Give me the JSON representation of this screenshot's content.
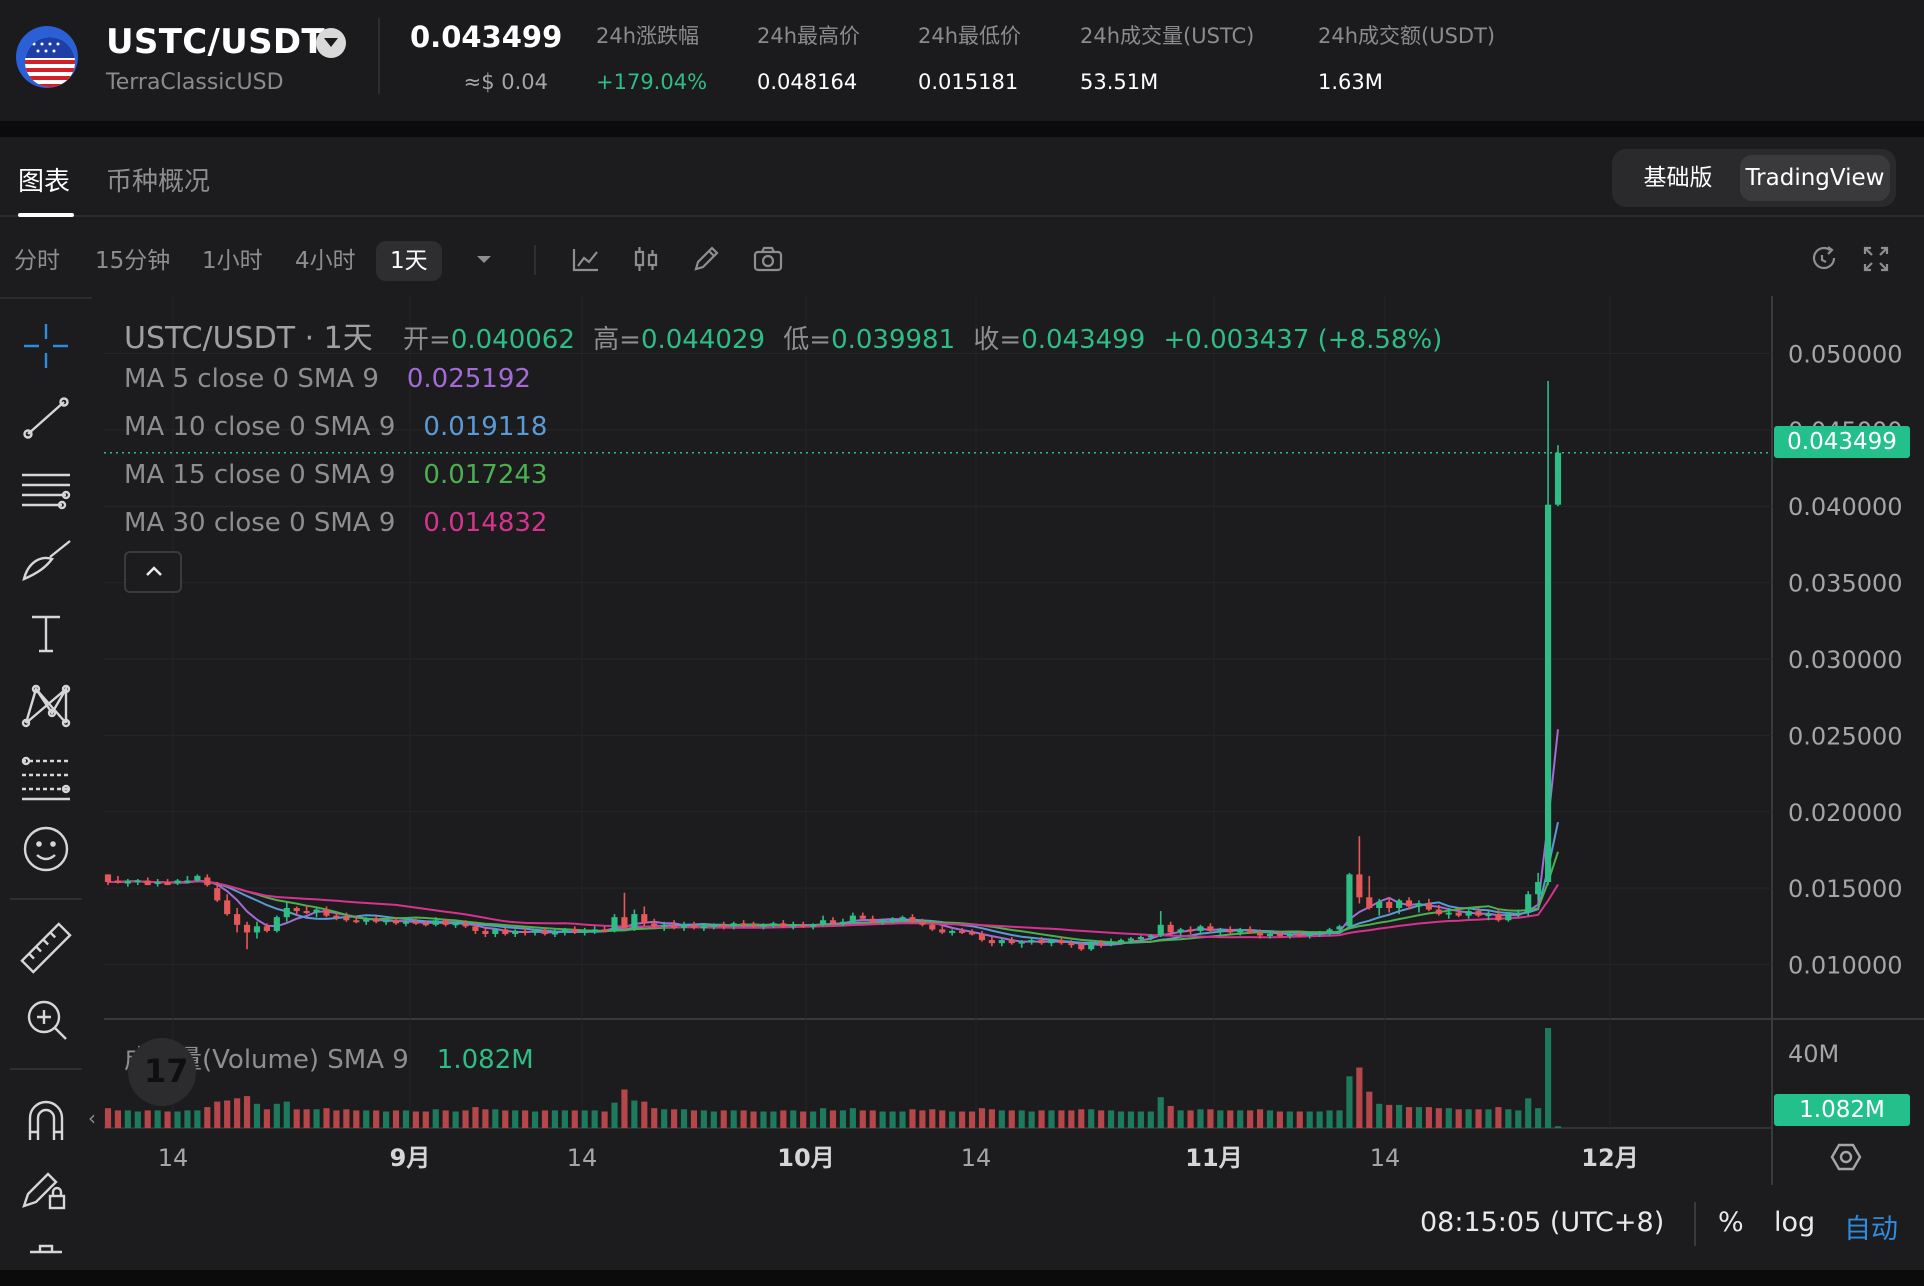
{
  "header": {
    "pair": "USTC/USDT",
    "subtitle": "TerraClassicUSD",
    "last_price": "0.043499",
    "last_price_usd": "≈$ 0.04",
    "stats": [
      {
        "label": "24h涨跌幅",
        "value": "+179.04%",
        "up": true
      },
      {
        "label": "24h最高价",
        "value": "0.048164",
        "up": false
      },
      {
        "label": "24h最低价",
        "value": "0.015181",
        "up": false
      },
      {
        "label": "24h成交量(USTC)",
        "value": "53.51M",
        "up": false
      },
      {
        "label": "24h成交额(USDT)",
        "value": "1.63M",
        "up": false
      }
    ]
  },
  "tabs": [
    {
      "label": "图表",
      "active": true
    },
    {
      "label": "币种概况",
      "active": false
    }
  ],
  "modes": [
    {
      "label": "基础版",
      "active": false
    },
    {
      "label": "TradingView",
      "active": true
    }
  ],
  "timeframes": [
    {
      "label": "分时",
      "active": false
    },
    {
      "label": "15分钟",
      "active": false
    },
    {
      "label": "1小时",
      "active": false
    },
    {
      "label": "4小时",
      "active": false
    },
    {
      "label": "1天",
      "active": true
    }
  ],
  "toolbar_icons": [
    "chevron-down-icon",
    "line-chart-icon",
    "candlestick-icon",
    "pencil-icon",
    "camera-icon",
    "refresh-icon",
    "fullscreen-icon"
  ],
  "side_icons": [
    "crosshair-icon",
    "trend-line-icon",
    "horizontal-lines-icon",
    "brush-icon",
    "text-icon",
    "pattern-icon",
    "fib-icon",
    "emoji-icon",
    "ruler-icon",
    "zoom-in-icon",
    "magnet-icon",
    "lock-draw-icon",
    "trash-icon"
  ],
  "ohlc": {
    "symbol": "USTC/USDT · 1天",
    "open_label": "开=",
    "open": "0.040062",
    "high_label": "高=",
    "high": "0.044029",
    "low_label": "低=",
    "low": "0.039981",
    "close_label": "收=",
    "close": "0.043499",
    "change": "+0.003437 (+8.58%)"
  },
  "ma_legend": [
    {
      "label": "MA 5 close 0 SMA 9",
      "value": "0.025192",
      "color": "#a46bd6"
    },
    {
      "label": "MA 10 close 0 SMA 9",
      "value": "0.019118",
      "color": "#5b9bd5"
    },
    {
      "label": "MA 15 close 0 SMA 9",
      "value": "0.017243",
      "color": "#4caf50"
    },
    {
      "label": "MA 30 close 0 SMA 9",
      "value": "0.014832",
      "color": "#d6338f"
    }
  ],
  "volume_legend": {
    "label": "成交量(Volume) SMA 9",
    "value": "1.082M"
  },
  "price_axis": [
    "0.050000",
    "0.045000",
    "0.040000",
    "0.035000",
    "0.030000",
    "0.025000",
    "0.020000",
    "0.015000",
    "0.010000"
  ],
  "current_price_tag": "0.043499",
  "volume_axis": "40M",
  "volume_tag": "1.082M",
  "time_axis": [
    "14",
    "9月",
    "14",
    "10月",
    "14",
    "11月",
    "14",
    "12月"
  ],
  "clock": "08:15:05 (UTC+8)",
  "bottom_options": [
    {
      "label": "%",
      "active": false
    },
    {
      "label": "log",
      "active": false
    },
    {
      "label": "自动",
      "active": true
    }
  ],
  "colors": {
    "up": "#26a17b",
    "up_bright": "#2ebd85",
    "down": "#e4585a",
    "price_line": "#24c08c"
  },
  "chart_data": {
    "type": "candlestick",
    "ylim": [
      0.0065,
      0.0535
    ],
    "y_ticks": [
      0.05,
      0.045,
      0.04,
      0.035,
      0.03,
      0.025,
      0.02,
      0.015,
      0.01
    ],
    "last_close": 0.043499,
    "candles": [
      [
        0.0159,
        0.0159,
        0.0152,
        0.0154
      ],
      [
        0.0155,
        0.0158,
        0.0153,
        0.0154
      ],
      [
        0.0153,
        0.0156,
        0.0151,
        0.0155
      ],
      [
        0.0154,
        0.0156,
        0.0152,
        0.0155
      ],
      [
        0.0155,
        0.0157,
        0.0152,
        0.0152
      ],
      [
        0.0153,
        0.0156,
        0.0151,
        0.0154
      ],
      [
        0.0154,
        0.0156,
        0.0152,
        0.0152
      ],
      [
        0.0153,
        0.0156,
        0.0152,
        0.0155
      ],
      [
        0.0155,
        0.0158,
        0.0153,
        0.0155
      ],
      [
        0.0155,
        0.0159,
        0.0154,
        0.0158
      ],
      [
        0.0157,
        0.0159,
        0.0151,
        0.0152
      ],
      [
        0.015,
        0.0154,
        0.0141,
        0.0142
      ],
      [
        0.0142,
        0.0146,
        0.0132,
        0.0133
      ],
      [
        0.0133,
        0.0137,
        0.0121,
        0.0126
      ],
      [
        0.0126,
        0.0128,
        0.011,
        0.0121
      ],
      [
        0.0121,
        0.0128,
        0.0117,
        0.0125
      ],
      [
        0.0125,
        0.0127,
        0.0121,
        0.0122
      ],
      [
        0.0122,
        0.0132,
        0.0121,
        0.0131
      ],
      [
        0.0131,
        0.0141,
        0.0128,
        0.0137
      ],
      [
        0.0137,
        0.0138,
        0.0132,
        0.0135
      ],
      [
        0.0135,
        0.0139,
        0.0133,
        0.0134
      ],
      [
        0.0134,
        0.0137,
        0.0131,
        0.0136
      ],
      [
        0.0136,
        0.0138,
        0.0131,
        0.0132
      ],
      [
        0.0132,
        0.0134,
        0.0129,
        0.0131
      ],
      [
        0.0131,
        0.0134,
        0.0128,
        0.0129
      ],
      [
        0.0129,
        0.0132,
        0.0127,
        0.0128
      ],
      [
        0.0128,
        0.0131,
        0.0126,
        0.013
      ],
      [
        0.013,
        0.0132,
        0.0127,
        0.0128
      ],
      [
        0.0128,
        0.013,
        0.0126,
        0.0129
      ],
      [
        0.0129,
        0.0131,
        0.0126,
        0.0127
      ],
      [
        0.0127,
        0.013,
        0.0125,
        0.0128
      ],
      [
        0.0128,
        0.013,
        0.0126,
        0.0127
      ],
      [
        0.0127,
        0.0129,
        0.0125,
        0.0126
      ],
      [
        0.0126,
        0.0131,
        0.0125,
        0.0129
      ],
      [
        0.0129,
        0.013,
        0.0125,
        0.0126
      ],
      [
        0.0126,
        0.0128,
        0.0124,
        0.0127
      ],
      [
        0.0127,
        0.0129,
        0.0124,
        0.0125
      ],
      [
        0.0125,
        0.0128,
        0.012,
        0.0122
      ],
      [
        0.0122,
        0.0124,
        0.0118,
        0.012
      ],
      [
        0.012,
        0.0124,
        0.0118,
        0.0123
      ],
      [
        0.0123,
        0.0124,
        0.0119,
        0.012
      ],
      [
        0.012,
        0.0123,
        0.0118,
        0.0122
      ],
      [
        0.0122,
        0.0124,
        0.0119,
        0.0121
      ],
      [
        0.0121,
        0.0123,
        0.0119,
        0.0122
      ],
      [
        0.0122,
        0.0124,
        0.0119,
        0.012
      ],
      [
        0.012,
        0.0123,
        0.0118,
        0.0121
      ],
      [
        0.0121,
        0.0124,
        0.0119,
        0.0123
      ],
      [
        0.0123,
        0.0125,
        0.012,
        0.0121
      ],
      [
        0.0121,
        0.0124,
        0.0119,
        0.0122
      ],
      [
        0.0122,
        0.0125,
        0.012,
        0.0123
      ],
      [
        0.0123,
        0.0125,
        0.0121,
        0.0122
      ],
      [
        0.0122,
        0.0133,
        0.0121,
        0.0131
      ],
      [
        0.0131,
        0.0147,
        0.0123,
        0.0124
      ],
      [
        0.0124,
        0.0136,
        0.0122,
        0.0133
      ],
      [
        0.0133,
        0.0138,
        0.0125,
        0.0127
      ],
      [
        0.0127,
        0.013,
        0.0123,
        0.0125
      ],
      [
        0.0125,
        0.0128,
        0.0122,
        0.0126
      ],
      [
        0.0126,
        0.0129,
        0.0123,
        0.0124
      ],
      [
        0.0124,
        0.0128,
        0.0122,
        0.0126
      ],
      [
        0.0126,
        0.0128,
        0.0123,
        0.0124
      ],
      [
        0.0124,
        0.0127,
        0.0122,
        0.0125
      ],
      [
        0.0125,
        0.0127,
        0.0123,
        0.0126
      ],
      [
        0.0126,
        0.0128,
        0.0123,
        0.0125
      ],
      [
        0.0125,
        0.0128,
        0.0123,
        0.0127
      ],
      [
        0.0127,
        0.0129,
        0.0124,
        0.0126
      ],
      [
        0.0126,
        0.0128,
        0.0124,
        0.0125
      ],
      [
        0.0125,
        0.0127,
        0.0123,
        0.0126
      ],
      [
        0.0126,
        0.0128,
        0.0124,
        0.0127
      ],
      [
        0.0127,
        0.0129,
        0.0124,
        0.0125
      ],
      [
        0.0125,
        0.0128,
        0.0123,
        0.0126
      ],
      [
        0.0126,
        0.0128,
        0.0124,
        0.0125
      ],
      [
        0.0125,
        0.0127,
        0.0123,
        0.0126
      ],
      [
        0.0126,
        0.0132,
        0.0125,
        0.0129
      ],
      [
        0.0129,
        0.0131,
        0.0126,
        0.0127
      ],
      [
        0.0127,
        0.013,
        0.0125,
        0.0128
      ],
      [
        0.0128,
        0.0134,
        0.0127,
        0.0132
      ],
      [
        0.0132,
        0.0134,
        0.0129,
        0.013
      ],
      [
        0.013,
        0.0132,
        0.0127,
        0.0128
      ],
      [
        0.0128,
        0.013,
        0.0126,
        0.0129
      ],
      [
        0.0129,
        0.0131,
        0.0127,
        0.013
      ],
      [
        0.013,
        0.0132,
        0.0128,
        0.0131
      ],
      [
        0.0131,
        0.0133,
        0.0127,
        0.0128
      ],
      [
        0.0128,
        0.013,
        0.0125,
        0.0126
      ],
      [
        0.0126,
        0.0128,
        0.0122,
        0.0123
      ],
      [
        0.0123,
        0.0125,
        0.012,
        0.0121
      ],
      [
        0.0121,
        0.0123,
        0.0119,
        0.0122
      ],
      [
        0.0122,
        0.0124,
        0.012,
        0.0121
      ],
      [
        0.0121,
        0.0123,
        0.0119,
        0.012
      ],
      [
        0.012,
        0.0122,
        0.0115,
        0.0116
      ],
      [
        0.0116,
        0.0118,
        0.0112,
        0.0114
      ],
      [
        0.0114,
        0.0117,
        0.0112,
        0.0116
      ],
      [
        0.0116,
        0.0118,
        0.0113,
        0.0114
      ],
      [
        0.0114,
        0.0116,
        0.0111,
        0.0115
      ],
      [
        0.0115,
        0.0117,
        0.0113,
        0.0116
      ],
      [
        0.0116,
        0.0118,
        0.0113,
        0.0114
      ],
      [
        0.0114,
        0.0117,
        0.0112,
        0.0116
      ],
      [
        0.0116,
        0.0118,
        0.0113,
        0.0114
      ],
      [
        0.0114,
        0.0116,
        0.0111,
        0.0113
      ],
      [
        0.0113,
        0.0115,
        0.0109,
        0.011
      ],
      [
        0.011,
        0.0115,
        0.0109,
        0.0114
      ],
      [
        0.0114,
        0.0116,
        0.0111,
        0.0113
      ],
      [
        0.0113,
        0.0117,
        0.0112,
        0.0115
      ],
      [
        0.0115,
        0.0117,
        0.0113,
        0.0116
      ],
      [
        0.0116,
        0.0118,
        0.0114,
        0.0117
      ],
      [
        0.0117,
        0.0119,
        0.0115,
        0.0118
      ],
      [
        0.0118,
        0.012,
        0.0116,
        0.0119
      ],
      [
        0.0119,
        0.0135,
        0.0118,
        0.0126
      ],
      [
        0.0126,
        0.0128,
        0.0119,
        0.0121
      ],
      [
        0.0121,
        0.0124,
        0.0119,
        0.0123
      ],
      [
        0.0123,
        0.0125,
        0.012,
        0.0122
      ],
      [
        0.0122,
        0.0126,
        0.012,
        0.0125
      ],
      [
        0.0125,
        0.0127,
        0.0121,
        0.0122
      ],
      [
        0.0122,
        0.0124,
        0.0119,
        0.0123
      ],
      [
        0.0123,
        0.0125,
        0.012,
        0.0121
      ],
      [
        0.0121,
        0.0124,
        0.0119,
        0.0123
      ],
      [
        0.0123,
        0.0125,
        0.012,
        0.0121
      ],
      [
        0.0121,
        0.0123,
        0.0117,
        0.0119
      ],
      [
        0.0119,
        0.0122,
        0.0117,
        0.012
      ],
      [
        0.012,
        0.0122,
        0.0118,
        0.0119
      ],
      [
        0.0119,
        0.0121,
        0.0117,
        0.012
      ],
      [
        0.012,
        0.0122,
        0.0118,
        0.0119
      ],
      [
        0.0119,
        0.0121,
        0.0117,
        0.012
      ],
      [
        0.012,
        0.0122,
        0.0118,
        0.0121
      ],
      [
        0.0121,
        0.0124,
        0.0119,
        0.0123
      ],
      [
        0.0123,
        0.0126,
        0.0121,
        0.0125
      ],
      [
        0.0125,
        0.016,
        0.0124,
        0.0159
      ],
      [
        0.0159,
        0.0184,
        0.014,
        0.0144
      ],
      [
        0.0144,
        0.0158,
        0.0136,
        0.0137
      ],
      [
        0.0137,
        0.0143,
        0.0132,
        0.0141
      ],
      [
        0.0141,
        0.0144,
        0.0134,
        0.0137
      ],
      [
        0.0137,
        0.0143,
        0.0133,
        0.0142
      ],
      [
        0.0142,
        0.0144,
        0.0136,
        0.0138
      ],
      [
        0.0138,
        0.0142,
        0.0134,
        0.014
      ],
      [
        0.014,
        0.0143,
        0.0135,
        0.0136
      ],
      [
        0.0136,
        0.0139,
        0.0132,
        0.0133
      ],
      [
        0.0133,
        0.0137,
        0.013,
        0.0134
      ],
      [
        0.0134,
        0.0137,
        0.0131,
        0.0132
      ],
      [
        0.0132,
        0.0136,
        0.013,
        0.0135
      ],
      [
        0.0135,
        0.0137,
        0.0131,
        0.0132
      ],
      [
        0.0132,
        0.0135,
        0.0129,
        0.0133
      ],
      [
        0.0133,
        0.0136,
        0.0128,
        0.0129
      ],
      [
        0.0129,
        0.0134,
        0.0128,
        0.0133
      ],
      [
        0.0133,
        0.0136,
        0.0131,
        0.0134
      ],
      [
        0.0134,
        0.0148,
        0.0132,
        0.0146
      ],
      [
        0.0146,
        0.016,
        0.0142,
        0.0154
      ],
      [
        0.0154,
        0.0482,
        0.0152,
        0.0401
      ],
      [
        0.0401,
        0.044,
        0.04,
        0.0435
      ]
    ],
    "ma_series": [
      {
        "name": "MA 5",
        "color": "#a46bd6",
        "end_value": 0.025192
      },
      {
        "name": "MA 10",
        "color": "#5b9bd5",
        "end_value": 0.019118
      },
      {
        "name": "MA 15",
        "color": "#4caf50",
        "end_value": 0.017243
      },
      {
        "name": "MA 30",
        "color": "#d6338f",
        "end_value": 0.014832
      }
    ]
  }
}
